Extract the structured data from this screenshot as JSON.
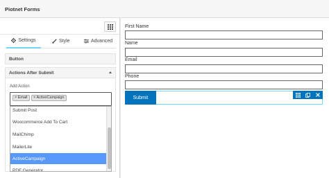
{
  "window": {
    "title": "Piotnet Forms"
  },
  "tabs": [
    {
      "label": "Settings",
      "icon": "gear-icon"
    },
    {
      "label": "Style",
      "icon": "brush-icon"
    },
    {
      "label": "Advanced",
      "icon": "sliders-icon"
    }
  ],
  "sections": {
    "button": {
      "label": "Button"
    },
    "actions_after_submit": {
      "label": "Actions After Submit",
      "field_label": "Add Action",
      "selected_tags": [
        "Email",
        "ActiveCampaign"
      ],
      "tag_remove_glyph": "×",
      "options": [
        "Submit Post",
        "Woocommerce Add To Cart",
        "MailChimp",
        "MailerLite",
        "ActiveCampaign",
        "PDF Generator"
      ],
      "highlighted_option": "ActiveCampaign"
    }
  },
  "form": {
    "fields": [
      {
        "label": "First Name",
        "value": ""
      },
      {
        "label": "Name",
        "value": ""
      },
      {
        "label": "Email",
        "value": ""
      },
      {
        "label": "Phone",
        "value": ""
      }
    ],
    "submit_label": "Submit",
    "toolbar_icons": [
      "grid-icon",
      "duplicate-icon",
      "close-icon"
    ]
  },
  "colors": {
    "accent": "#71d7f7",
    "submit_bg": "#0274be",
    "highlight": "#5897fb"
  }
}
